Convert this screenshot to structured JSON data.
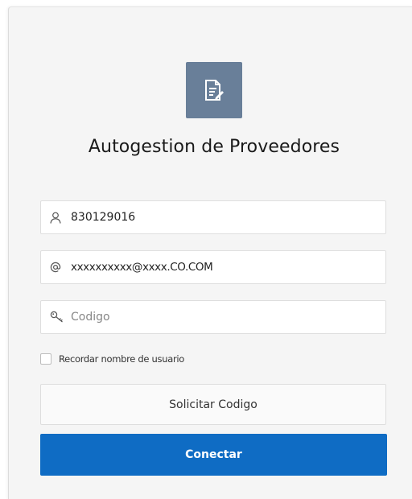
{
  "app": {
    "title": "Autogestion de Proveedores",
    "icon": "document-edit-icon"
  },
  "form": {
    "username": {
      "value": "830129016",
      "icon": "user-icon"
    },
    "email": {
      "value": "xxxxxxxxxx@xxxx.CO.COM",
      "icon": "at-sign-icon"
    },
    "code": {
      "value": "",
      "placeholder": "Codigo",
      "icon": "key-icon"
    },
    "remember": {
      "label": "Recordar nombre de usuario",
      "checked": false
    }
  },
  "buttons": {
    "request_code": "Solicitar Codigo",
    "connect": "Conectar"
  },
  "colors": {
    "app_icon_bg": "#697f99",
    "primary": "#0f6cc4",
    "card_bg": "#f5f5f5"
  }
}
